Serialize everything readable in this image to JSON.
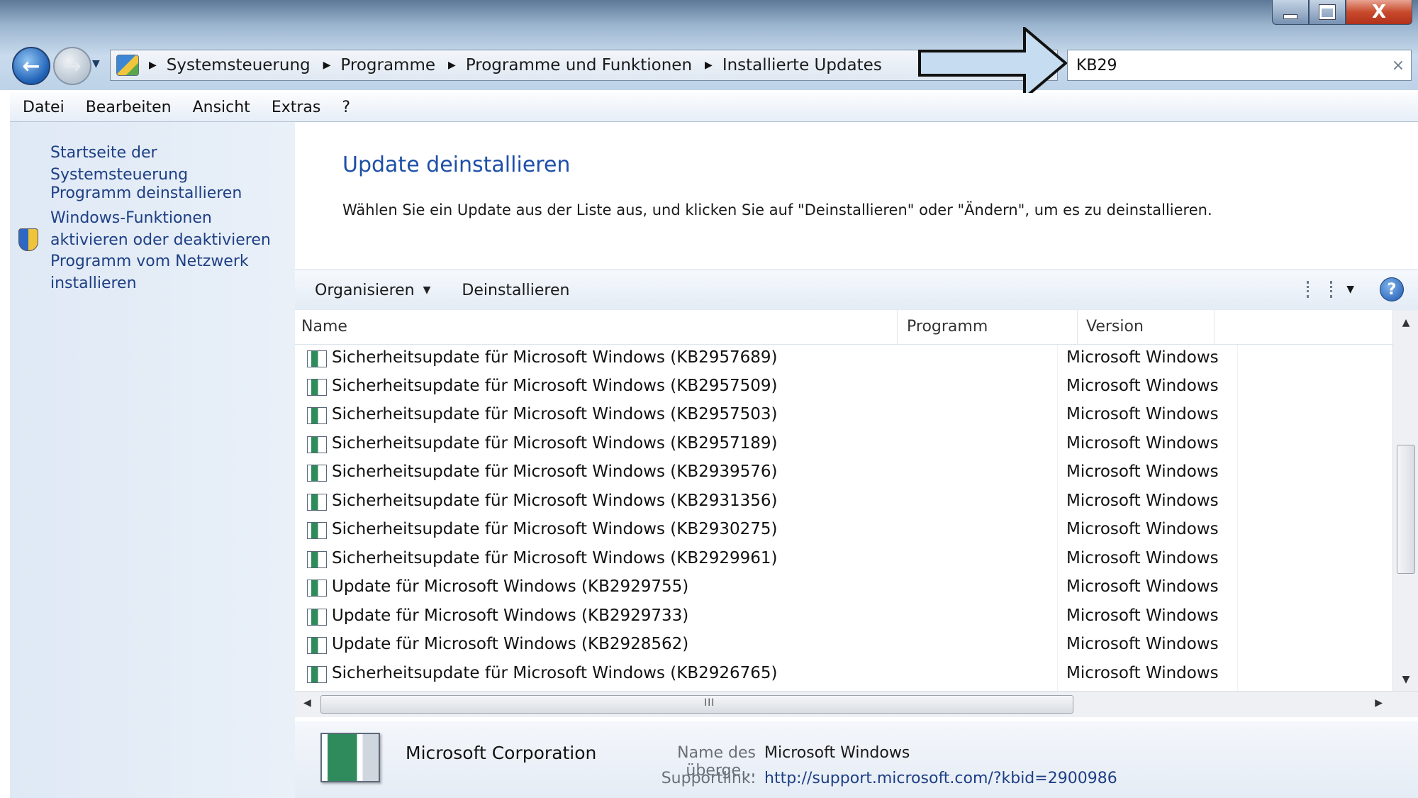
{
  "window": {
    "min_icon": "minimize-icon",
    "max_icon": "maximize-icon",
    "close_label": "X"
  },
  "nav": {
    "back_icon": "back-arrow-icon",
    "forward_icon": "forward-arrow-icon",
    "history_icon": "chevron-down-icon"
  },
  "address": {
    "icon": "control-panel-icon",
    "crumbs": [
      "Systemsteuerung",
      "Programme",
      "Programme und Funktionen",
      "Installierte Updates"
    ]
  },
  "search": {
    "value": "KB29",
    "clear_label": "×"
  },
  "menu": [
    "Datei",
    "Bearbeiten",
    "Ansicht",
    "Extras",
    "?"
  ],
  "sidebar": {
    "home": "Startseite der Systemsteuerung",
    "uninstall": "Programm deinstallieren",
    "features_line1": "Windows-Funktionen",
    "features_line2": "aktivieren oder deaktivieren",
    "network_line1": "Programm vom Netzwerk",
    "network_line2": "installieren",
    "shield_icon": "uac-shield-icon"
  },
  "main": {
    "title": "Update deinstallieren",
    "description": "Wählen Sie ein Update aus der Liste aus, und klicken Sie auf \"Deinstallieren\" oder \"Ändern\", um es zu deinstallieren."
  },
  "toolbar": {
    "organize": "Organisieren",
    "uninstall": "Deinstallieren",
    "view_icon": "view-options-icon",
    "help_label": "?"
  },
  "table": {
    "columns": [
      "Name",
      "Programm",
      "Version"
    ],
    "rows": [
      {
        "name": "Sicherheitsupdate für Microsoft Windows (KB2957689)",
        "program": "Microsoft Windows"
      },
      {
        "name": "Sicherheitsupdate für Microsoft Windows (KB2957509)",
        "program": "Microsoft Windows"
      },
      {
        "name": "Sicherheitsupdate für Microsoft Windows (KB2957503)",
        "program": "Microsoft Windows"
      },
      {
        "name": "Sicherheitsupdate für Microsoft Windows (KB2957189)",
        "program": "Microsoft Windows"
      },
      {
        "name": "Sicherheitsupdate für Microsoft Windows (KB2939576)",
        "program": "Microsoft Windows"
      },
      {
        "name": "Sicherheitsupdate für Microsoft Windows (KB2931356)",
        "program": "Microsoft Windows"
      },
      {
        "name": "Sicherheitsupdate für Microsoft Windows (KB2930275)",
        "program": "Microsoft Windows"
      },
      {
        "name": "Sicherheitsupdate für Microsoft Windows (KB2929961)",
        "program": "Microsoft Windows"
      },
      {
        "name": "Update für Microsoft Windows (KB2929755)",
        "program": "Microsoft Windows"
      },
      {
        "name": "Update für Microsoft Windows (KB2929733)",
        "program": "Microsoft Windows"
      },
      {
        "name": "Update für Microsoft Windows (KB2928562)",
        "program": "Microsoft Windows"
      },
      {
        "name": "Sicherheitsupdate für Microsoft Windows (KB2926765)",
        "program": "Microsoft Windows"
      }
    ]
  },
  "scroll": {
    "grip": "III"
  },
  "details": {
    "publisher": "Microsoft Corporation",
    "parent_label": "Name des überge...",
    "parent_value": "Microsoft Windows",
    "support_label": "Supportlink:",
    "support_value": "http://support.microsoft.com/?kbid=2900986"
  }
}
